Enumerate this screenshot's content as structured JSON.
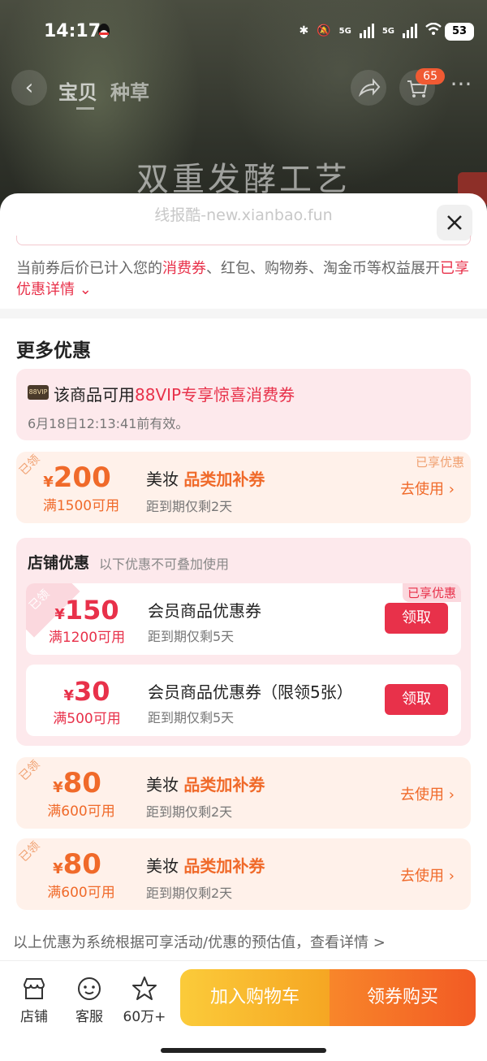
{
  "status_bar": {
    "time": "14:17",
    "battery": "53",
    "signal1": "5G",
    "signal2": "5G"
  },
  "nav": {
    "tabs": [
      "宝贝",
      "种草"
    ],
    "cart_badge": "65"
  },
  "hero": {
    "caption": "双重发酵工艺"
  },
  "sheet": {
    "watermark": "线报酷-new.xianbao.fun",
    "notice_prefix": "当前券后价已计入您的",
    "notice_highlight": "消费券",
    "notice_middle": "、红包、购物券、淘金币等权益展开",
    "notice_link": "已享优惠详情",
    "section_title": "更多优惠",
    "vip": {
      "badge": "88VIP",
      "title_prefix": "该商品可用",
      "title_highlight": "88VIP专享惊喜消费券",
      "subtitle": "6月18日12:13:41前有效。"
    },
    "coupons": [
      {
        "stamp": "已领",
        "yen": "¥",
        "amount": "200",
        "condition": "满1500可用",
        "name_prefix": "美妆",
        "name_accent": "品类加补券",
        "expire": "距到期仅剩2天",
        "action": "去使用",
        "enjoyed": "已享优惠"
      },
      {
        "stamp": "已领",
        "yen": "¥",
        "amount": "80",
        "condition": "满600可用",
        "name_prefix": "美妆",
        "name_accent": "品类加补券",
        "expire": "距到期仅剩2天",
        "action": "去使用"
      },
      {
        "stamp": "已领",
        "yen": "¥",
        "amount": "80",
        "condition": "满600可用",
        "name_prefix": "美妆",
        "name_accent": "品类加补券",
        "expire": "距到期仅剩2天",
        "action": "去使用"
      }
    ],
    "store": {
      "title": "店铺优惠",
      "note": "以下优惠不可叠加使用",
      "cards": [
        {
          "stamp": "已领",
          "yen": "¥",
          "amount": "150",
          "condition": "满1200可用",
          "name": "会员商品优惠券",
          "expire": "距到期仅剩5天",
          "claim": "领取",
          "enjoyed": "已享优惠"
        },
        {
          "yen": "¥",
          "amount": "30",
          "condition": "满500可用",
          "name": "会员商品优惠券（限领5张）",
          "expire": "距到期仅剩5天",
          "claim": "领取"
        }
      ]
    },
    "footer_note": "以上优惠为系统根据可享活动/优惠的预估值，查看详情 >"
  },
  "bottom_bar": {
    "store_label": "店铺",
    "service_label": "客服",
    "fav_label": "60万+",
    "add_cart": "加入购物车",
    "buy": "领券购买"
  }
}
